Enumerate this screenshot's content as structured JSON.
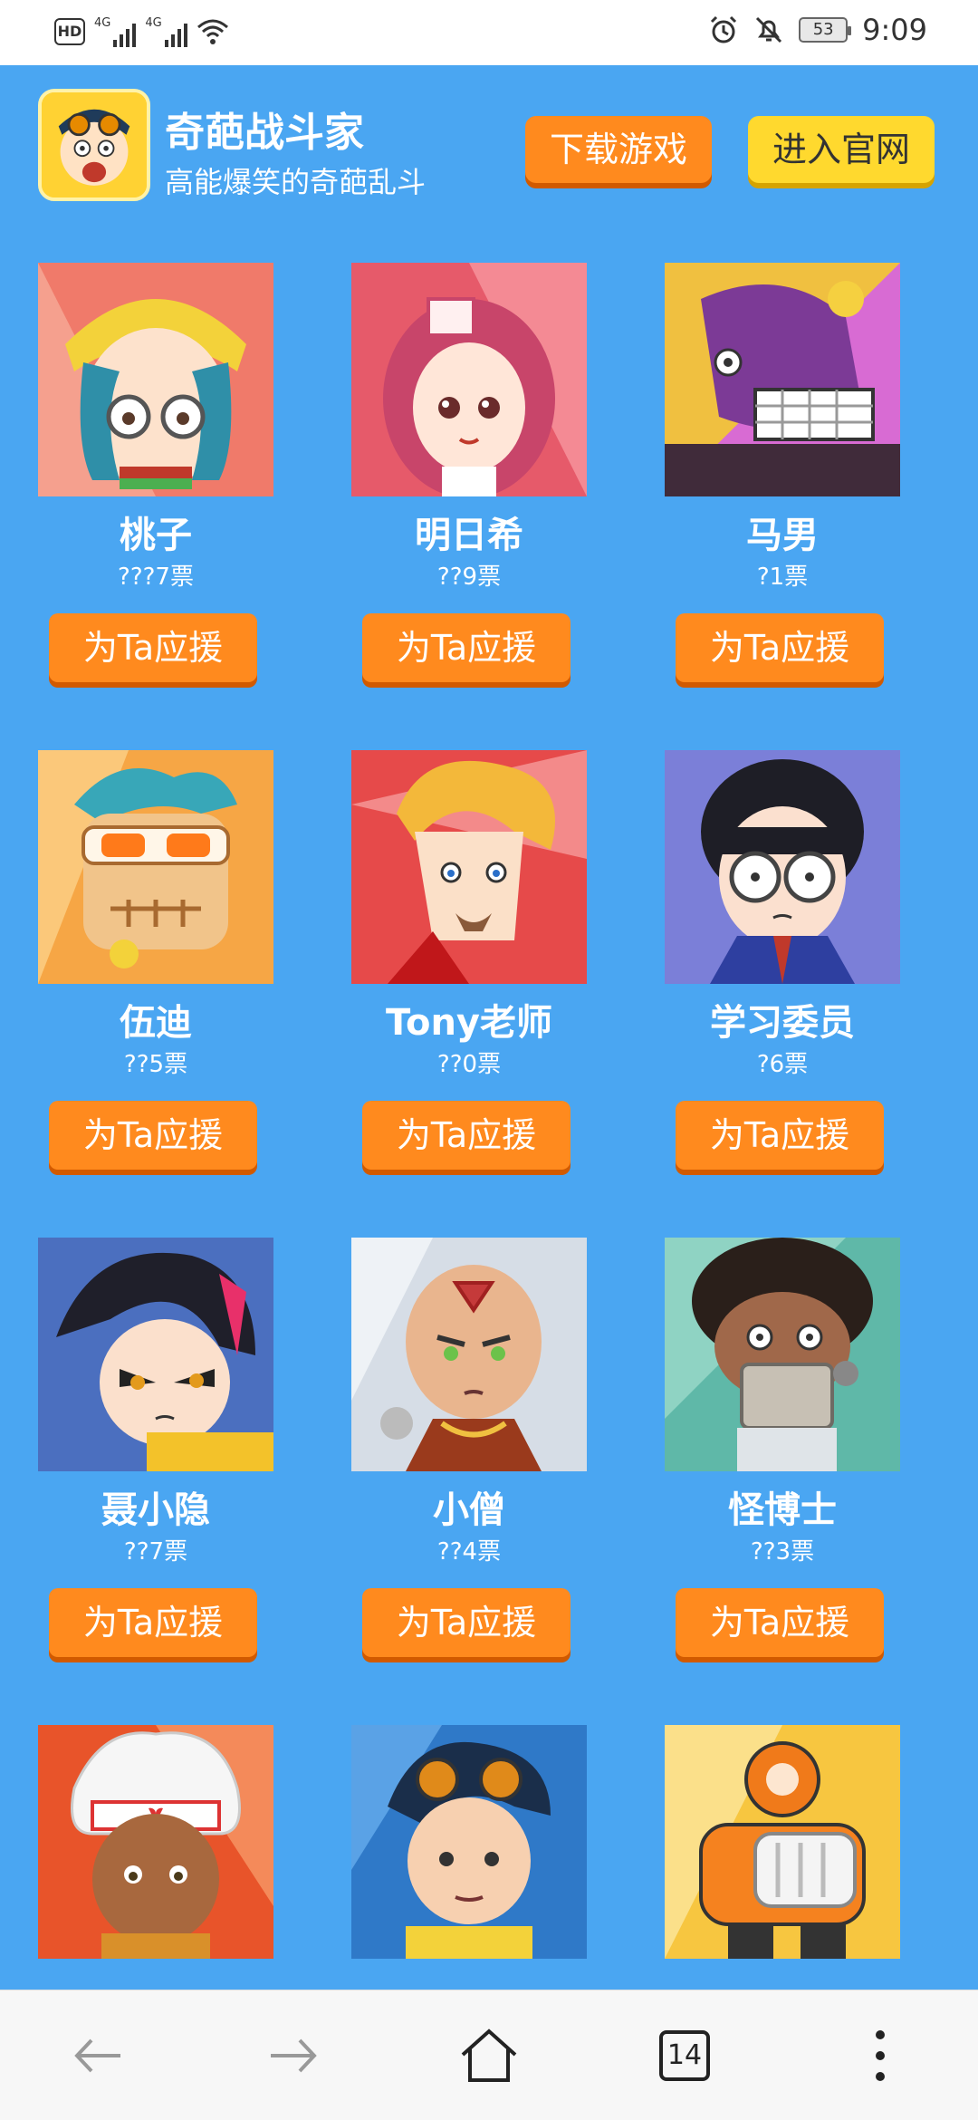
{
  "status_bar": {
    "hd": "HD",
    "net1": "4G",
    "net2": "4G",
    "battery": "53",
    "time": "9:09"
  },
  "header": {
    "title": "奇葩战斗家",
    "subtitle": "高能爆笑的奇葩乱斗",
    "download_label": "下载游戏",
    "official_label": "进入官网"
  },
  "support_label": "为Ta应援",
  "characters": [
    {
      "name": "桃子",
      "votes": "???7票"
    },
    {
      "name": "明日希",
      "votes": "??9票"
    },
    {
      "name": "马男",
      "votes": "?1票"
    },
    {
      "name": "伍迪",
      "votes": "??5票"
    },
    {
      "name": "Tony老师",
      "votes": "??0票"
    },
    {
      "name": "学习委员",
      "votes": "?6票"
    },
    {
      "name": "聂小隐",
      "votes": "??7票"
    },
    {
      "name": "小僧",
      "votes": "??4票"
    },
    {
      "name": "怪博士",
      "votes": "??3票"
    },
    {
      "name": "",
      "votes": ""
    },
    {
      "name": "",
      "votes": ""
    },
    {
      "name": "",
      "votes": ""
    }
  ],
  "bottom_nav": {
    "tabs_count": "14"
  }
}
